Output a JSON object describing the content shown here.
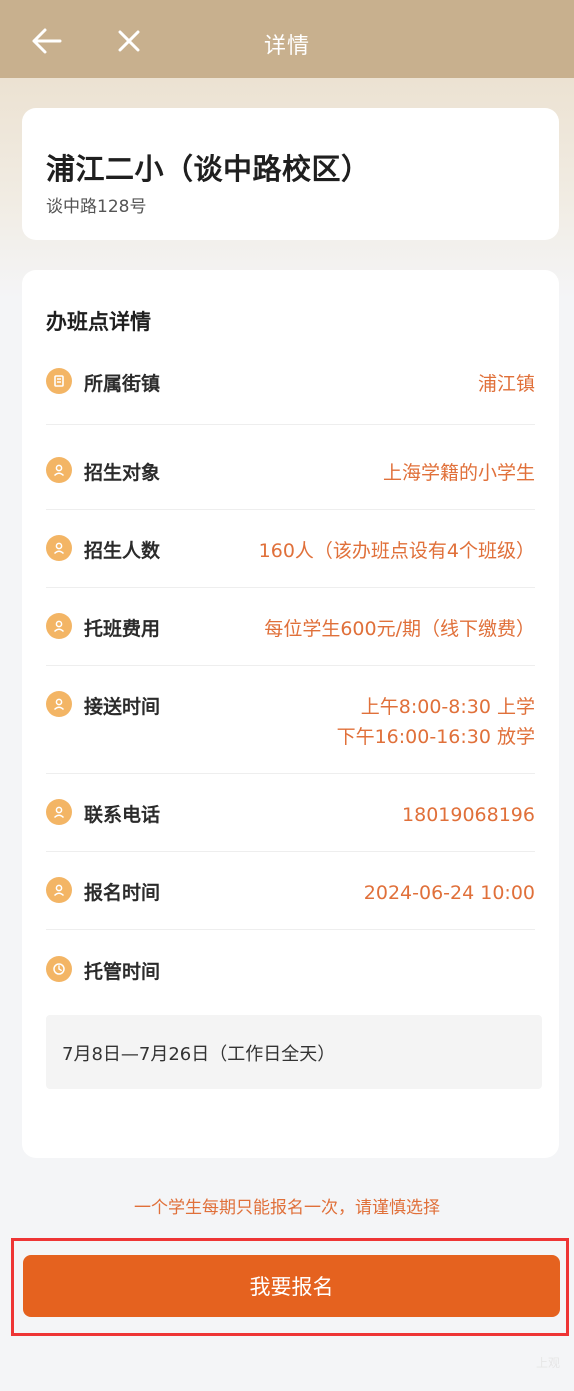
{
  "header": {
    "title": "详情",
    "back_icon": "arrow-left-icon",
    "close_icon": "close-icon",
    "background_color": "#c8b08e"
  },
  "school": {
    "name": "浦江二小（谈中路校区）",
    "address": "谈中路128号"
  },
  "details": {
    "section_title": "办班点详情",
    "rows": [
      {
        "label": "所属街镇",
        "value": [
          "浦江镇"
        ],
        "icon": "document-icon"
      },
      {
        "label": "招生对象",
        "value": [
          "上海学籍的小学生"
        ],
        "icon": "person-icon"
      },
      {
        "label": "招生人数",
        "value": [
          "160人（该办班点设有4个班级）"
        ],
        "icon": "person-icon"
      },
      {
        "label": "托班费用",
        "value": [
          "每位学生600元/期（线下缴费）"
        ],
        "icon": "person-icon"
      },
      {
        "label": "接送时间",
        "value": [
          "上午8:00-8:30 上学",
          "下午16:00-16:30 放学"
        ],
        "icon": "person-icon"
      },
      {
        "label": "联系电话",
        "value": [
          "18019068196"
        ],
        "icon": "person-icon"
      },
      {
        "label": "报名时间",
        "value": [
          "2024-06-24 10:00"
        ],
        "icon": "person-icon"
      },
      {
        "label": "托管时间",
        "value": [],
        "icon": "clock-icon"
      }
    ],
    "custody_note": "7月8日—7月26日（工作日全天）"
  },
  "footer": {
    "warning": "一个学生每期只能报名一次，请谨慎选择",
    "signup_button": "我要报名",
    "watermark": "上观"
  },
  "colors": {
    "accent": "#e5621f",
    "value_text": "#e0703a",
    "icon": "#f3b565",
    "highlight_frame": "#ee3535"
  }
}
